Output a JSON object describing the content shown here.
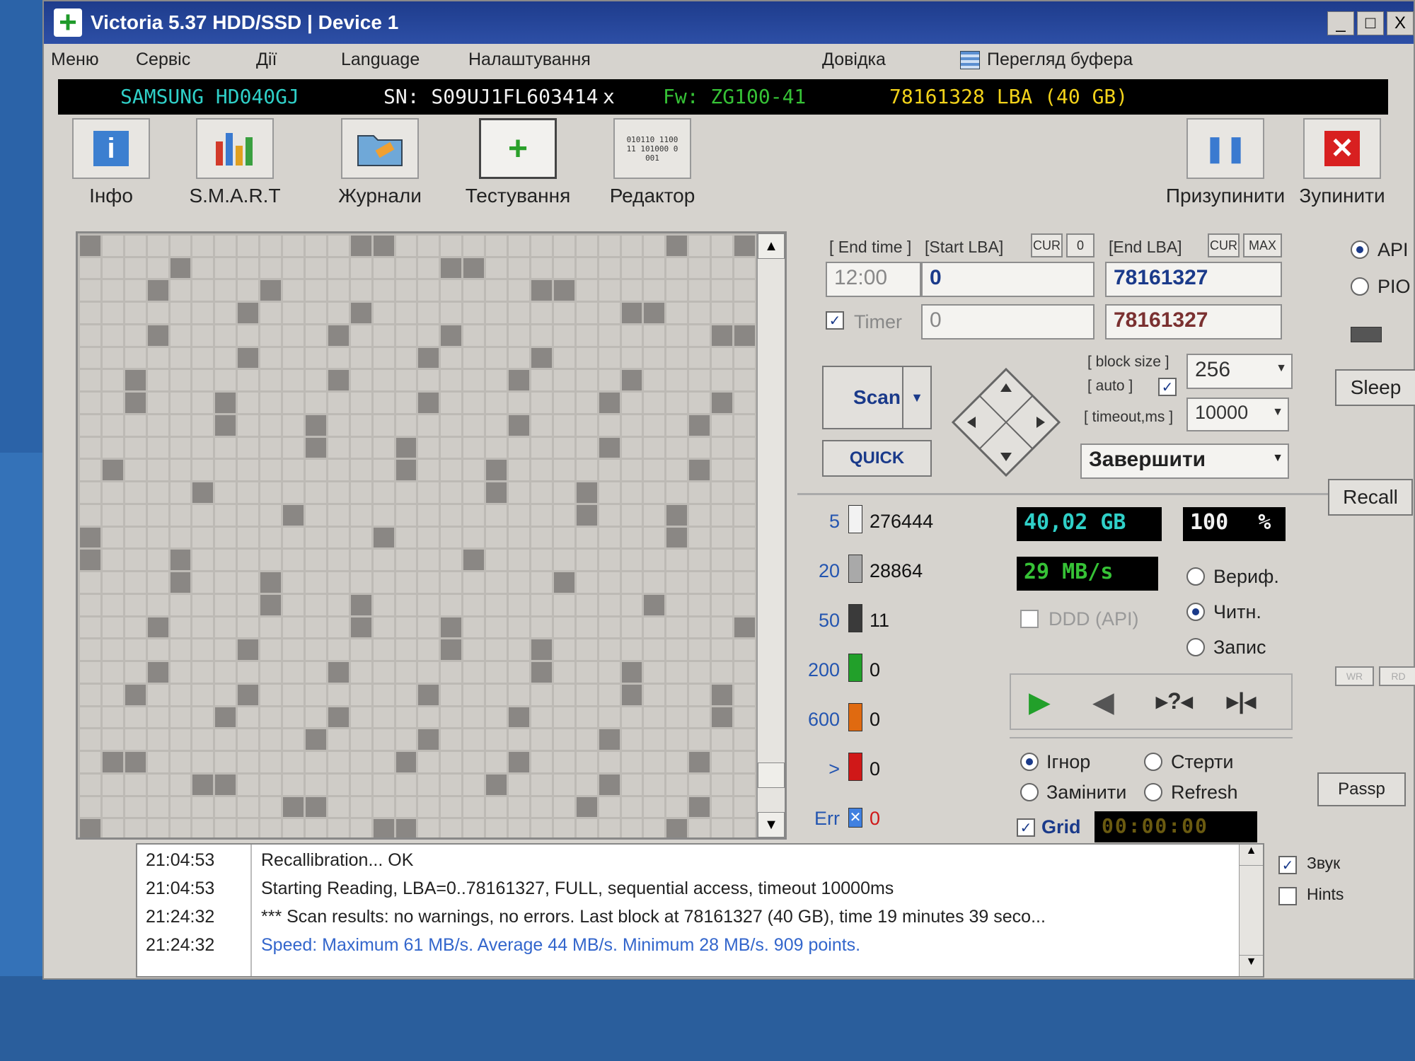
{
  "window": {
    "title": "Victoria 5.37 HDD/SSD | Device 1",
    "controls": {
      "minimize": "_",
      "maximize": "□",
      "close": "X"
    }
  },
  "menu": {
    "items": [
      "Меню",
      "Сервіс",
      "Дії",
      "Language",
      "Налаштування",
      "Довідка"
    ],
    "buffer_view": "Перегляд буфера"
  },
  "device": {
    "model": "SAMSUNG HD040GJ",
    "serial": "SN: S09UJ1FL603414",
    "close": "x",
    "firmware": "Fw: ZG100-41",
    "capacity": "78161328 LBA (40 GB)"
  },
  "toolbar": {
    "info": "Інфо",
    "smart": "S.M.A.R.T",
    "logs": "Журнали",
    "testing": "Тестування",
    "editor": "Редактор",
    "editor_icon_text": "010110 110011 101000 0001",
    "pause": "Призупинити",
    "stop": "Зупинити"
  },
  "scan": {
    "end_time_label": "[ End time ]",
    "end_time_value": "12:00",
    "timer_label": "Timer",
    "start_lba_label": "[Start LBA]",
    "cur_label": "CUR",
    "zero_label": "0",
    "end_lba_label": "[End LBA]",
    "max_label": "MAX",
    "start_lba": "0",
    "end_lba": "78161327",
    "start_lba_2": "0",
    "end_lba_2": "78161327",
    "block_size_label": "[ block size ]",
    "block_size": "256",
    "auto_label": "[ auto ]",
    "timeout_label": "[ timeout,ms ]",
    "timeout": "10000",
    "scan_button": "Scan",
    "quick_button": "QUICK",
    "action_select": "Завершити"
  },
  "stats": {
    "rows": [
      {
        "threshold": "5",
        "count": "276444",
        "color": "#f2f2f2"
      },
      {
        "threshold": "20",
        "count": "28864",
        "color": "#a9a9a9"
      },
      {
        "threshold": "50",
        "count": "11",
        "color": "#3a3a3a"
      },
      {
        "threshold": "200",
        "count": "0",
        "color": "#22a02a"
      },
      {
        "threshold": "600",
        "count": "0",
        "color": "#e06a10"
      },
      {
        "threshold": ">",
        "count": "0",
        "color": "#d01818"
      }
    ],
    "err_label": "Err",
    "err_count": "0",
    "size_done": "40,02 GB",
    "percent": "100",
    "percent_sign": "%",
    "speed": "29 MB/s",
    "ddd_label": "DDD (API)",
    "mode_verify": "Вериф.",
    "mode_read": "Читн.",
    "mode_write": "Запис",
    "opt_ignore": "Ігнор",
    "opt_erase": "Стерти",
    "opt_replace": "Замінити",
    "opt_refresh": "Refresh",
    "grid_label": "Grid",
    "elapsed": "00:00:00"
  },
  "side": {
    "api": "API",
    "pio": "PIO",
    "sleep": "Sleep",
    "recall": "Recall",
    "wr": "WR",
    "rd": "RD",
    "passp": "Passp",
    "sound": "Звук",
    "hints": "Hints"
  },
  "log": [
    {
      "time": "21:04:53",
      "msg": "Recallibration... OK",
      "blue": false
    },
    {
      "time": "21:04:53",
      "msg": "Starting Reading, LBA=0..78161327, FULL, sequential access, timeout 10000ms",
      "blue": false
    },
    {
      "time": "21:24:32",
      "msg": "*** Scan results: no warnings, no errors. Last block at 78161327 (40 GB), time 19 minutes 39 seco...",
      "blue": false
    },
    {
      "time": "21:24:32",
      "msg": "Speed: Maximum 61 MB/s. Average 44 MB/s. Minimum 28 MB/s. 909 points.",
      "blue": true
    }
  ]
}
